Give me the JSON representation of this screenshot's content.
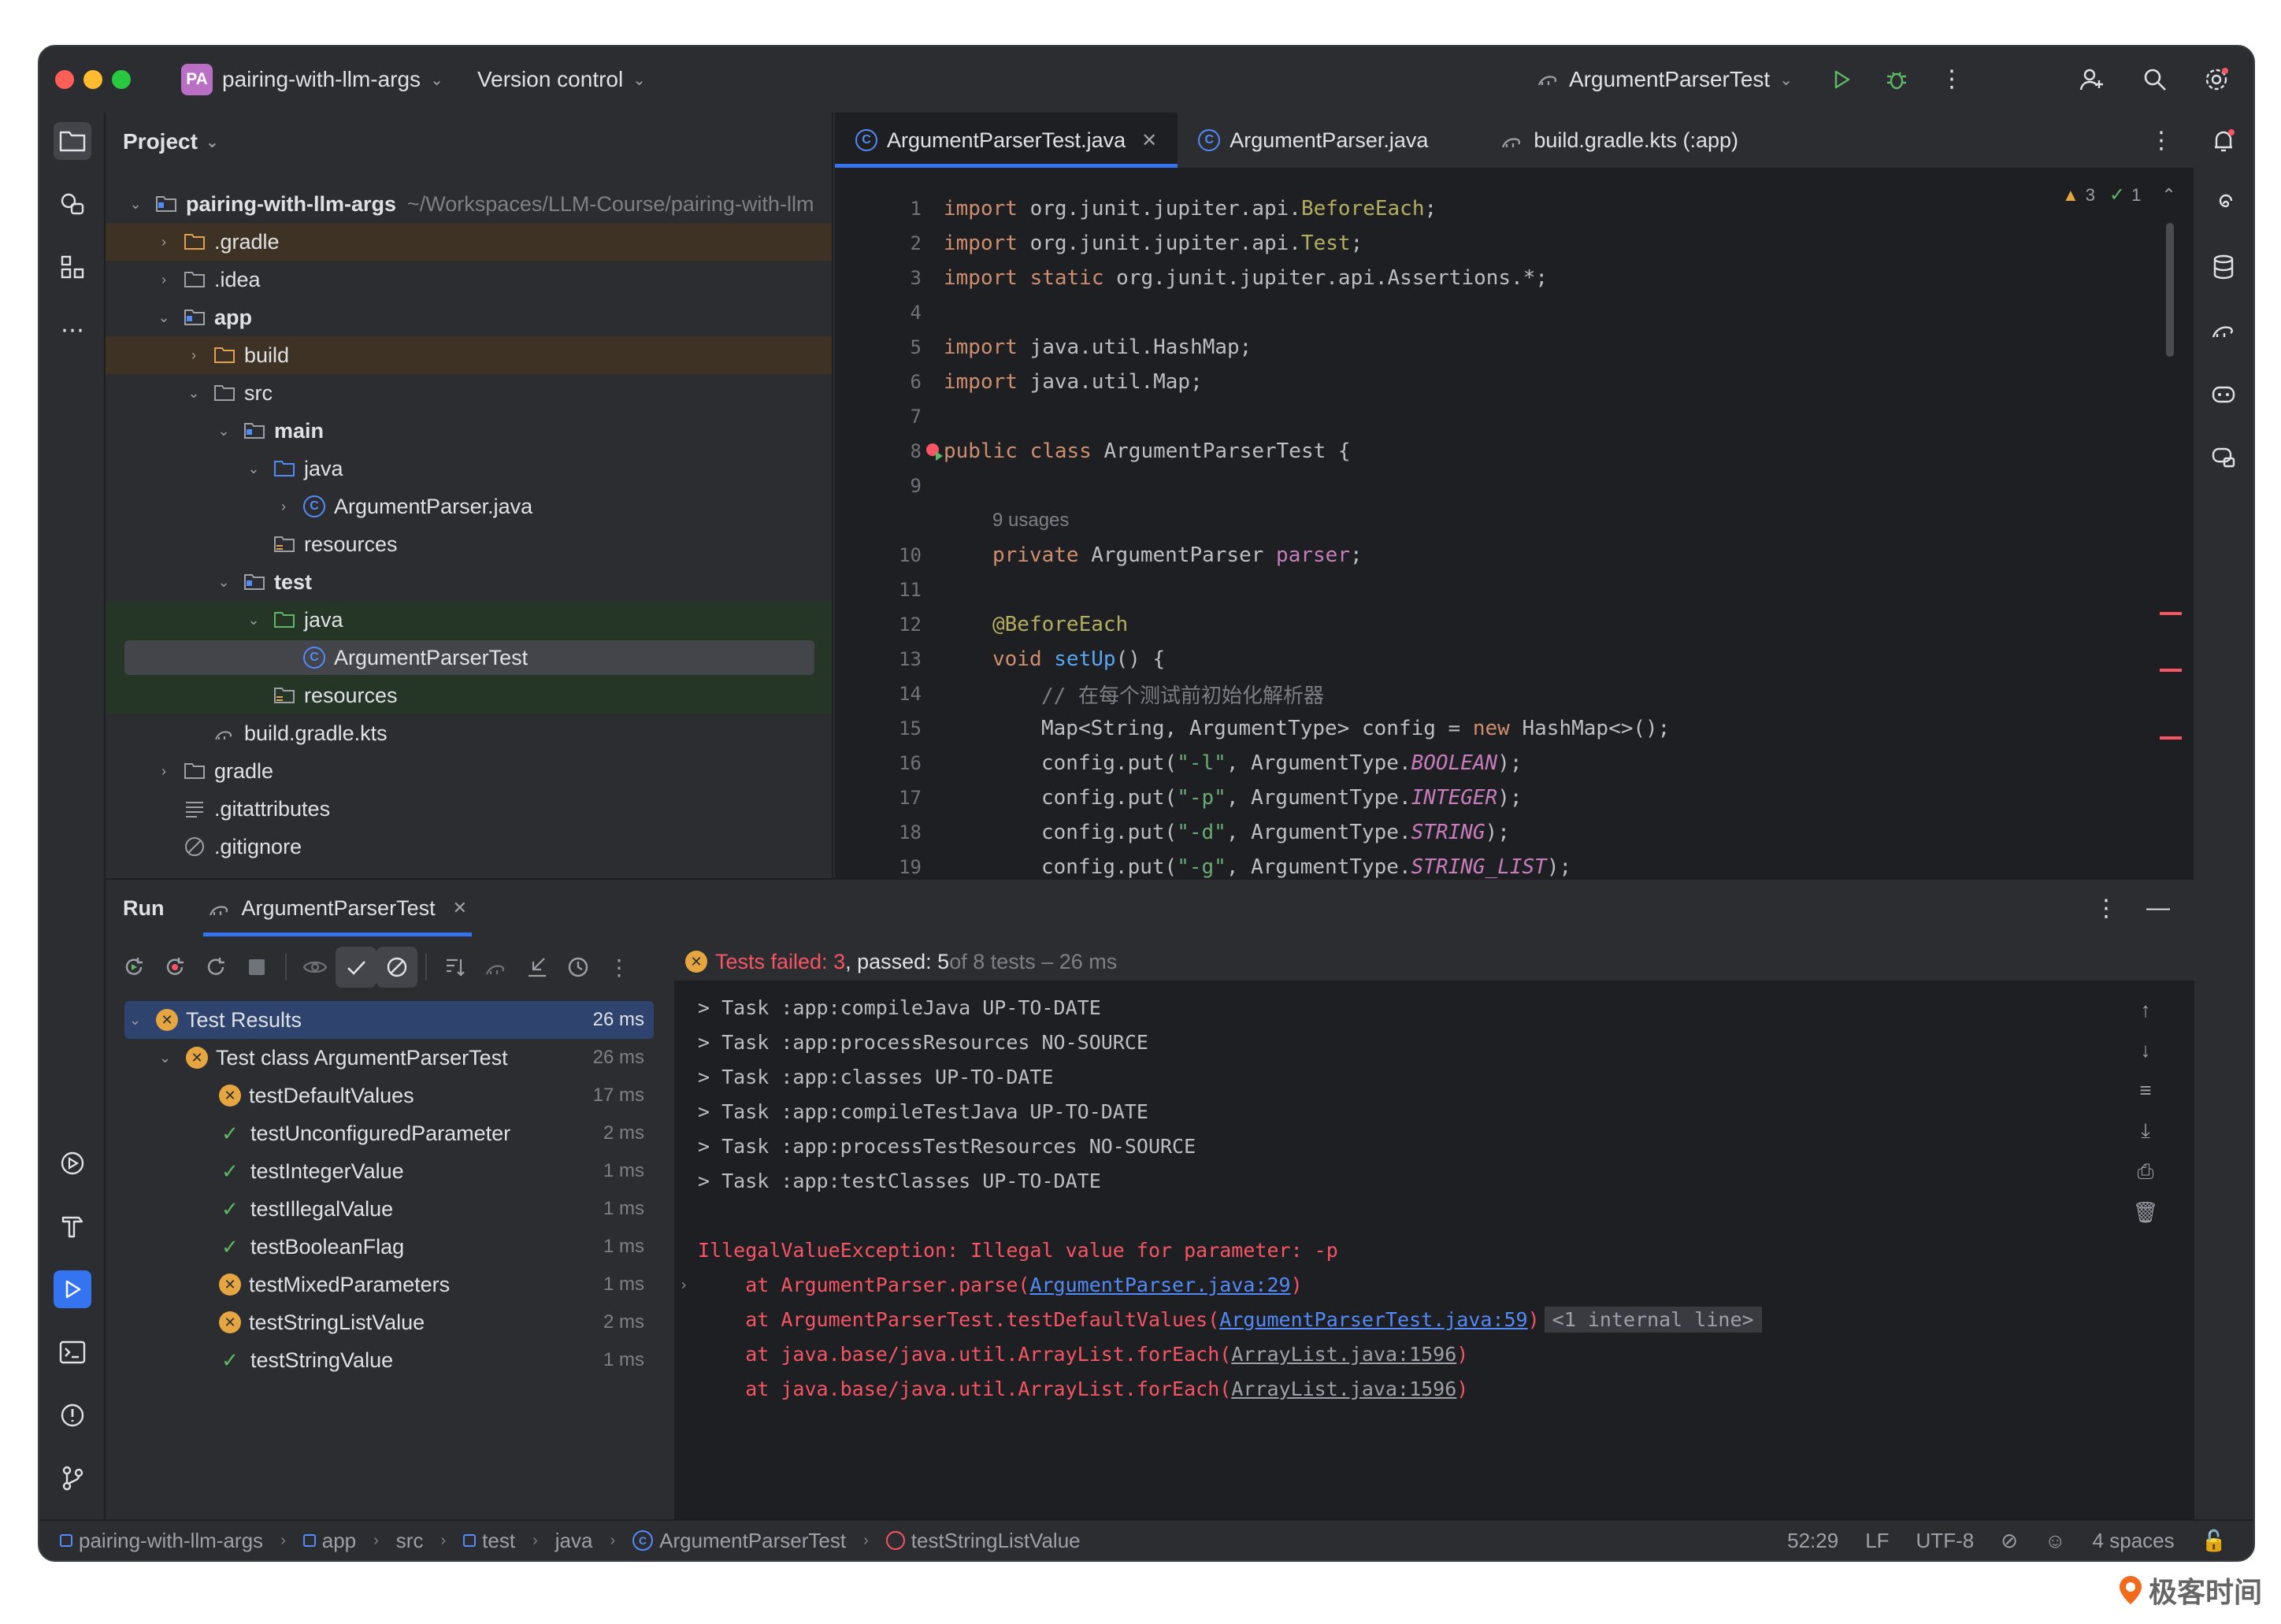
{
  "titlebar": {
    "project_badge": "PA",
    "project_name": "pairing-with-llm-args",
    "version_control": "Version control",
    "run_config": "ArgumentParserTest"
  },
  "project_panel": {
    "title": "Project",
    "root_name": "pairing-with-llm-args",
    "root_path": "~/Workspaces/LLM-Course/pairing-with-llm",
    "items": [
      {
        "label": ".gradle"
      },
      {
        "label": ".idea"
      },
      {
        "label": "app"
      },
      {
        "label": "build"
      },
      {
        "label": "src"
      },
      {
        "label": "main"
      },
      {
        "label": "java"
      },
      {
        "label": "ArgumentParser.java"
      },
      {
        "label": "resources"
      },
      {
        "label": "test"
      },
      {
        "label": "java"
      },
      {
        "label": "ArgumentParserTest"
      },
      {
        "label": "resources"
      },
      {
        "label": "build.gradle.kts"
      },
      {
        "label": "gradle"
      },
      {
        "label": ".gitattributes"
      },
      {
        "label": ".gitignore"
      }
    ]
  },
  "editor": {
    "tabs": [
      {
        "label": "ArgumentParserTest.java"
      },
      {
        "label": "ArgumentParser.java"
      },
      {
        "label": "build.gradle.kts (:app)"
      }
    ],
    "inspection": {
      "warnings": "3",
      "checks": "1"
    },
    "line_numbers": [
      "1",
      "2",
      "3",
      "4",
      "5",
      "6",
      "7",
      "8",
      "9",
      "10",
      "11",
      "12",
      "13",
      "14",
      "15",
      "16",
      "17",
      "18",
      "19"
    ],
    "usages_hint": "9 usages",
    "lines": {
      "l1": [
        "import ",
        "org.junit.jupiter.api.",
        "BeforeEach",
        ";"
      ],
      "l2": [
        "import ",
        "org.junit.jupiter.api.",
        "Test",
        ";"
      ],
      "l3": [
        "import static ",
        "org.junit.jupiter.api.Assertions.*;"
      ],
      "l5": [
        "import ",
        "java.util.HashMap;"
      ],
      "l6": [
        "import ",
        "java.util.Map;"
      ],
      "l8": [
        "public class ",
        "ArgumentParserTest {"
      ],
      "l10": [
        "private ",
        "ArgumentParser ",
        "parser",
        ";"
      ],
      "l12": [
        "@BeforeEach"
      ],
      "l13": [
        "void ",
        "setUp",
        "() {"
      ],
      "l14": [
        "// 在每个测试前初始化解析器"
      ],
      "l15": [
        "Map<String, ArgumentType> config = ",
        "new ",
        "HashMap<>();"
      ],
      "l16": [
        "config.put(",
        "\"-l\"",
        ", ArgumentType.",
        "BOOLEAN",
        ");"
      ],
      "l17": [
        "config.put(",
        "\"-p\"",
        ", ArgumentType.",
        "INTEGER",
        ");"
      ],
      "l18": [
        "config.put(",
        "\"-d\"",
        ", ArgumentType.",
        "STRING",
        ");"
      ],
      "l19": [
        "config.put(",
        "\"-g\"",
        ", ArgumentType.",
        "STRING_LIST",
        ");"
      ]
    }
  },
  "run_panel": {
    "title": "Run",
    "tab_label": "ArgumentParserTest",
    "summary": {
      "failed": "Tests failed: 3",
      "passed": ", passed: 5",
      "rest": " of 8 tests – 26 ms"
    },
    "results": [
      {
        "label": "Test Results",
        "time": "26 ms",
        "status": "fail"
      },
      {
        "label": "Test class ArgumentParserTest",
        "time": "26 ms",
        "status": "fail"
      },
      {
        "label": "testDefaultValues",
        "time": "17 ms",
        "status": "fail"
      },
      {
        "label": "testUnconfiguredParameter",
        "time": "2 ms",
        "status": "pass"
      },
      {
        "label": "testIntegerValue",
        "time": "1 ms",
        "status": "pass"
      },
      {
        "label": "testIllegalValue",
        "time": "1 ms",
        "status": "pass"
      },
      {
        "label": "testBooleanFlag",
        "time": "1 ms",
        "status": "pass"
      },
      {
        "label": "testMixedParameters",
        "time": "1 ms",
        "status": "fail"
      },
      {
        "label": "testStringListValue",
        "time": "2 ms",
        "status": "fail"
      },
      {
        "label": "testStringValue",
        "time": "1 ms",
        "status": "pass"
      }
    ],
    "console": {
      "tasks": [
        "> Task :app:compileJava UP-TO-DATE",
        "> Task :app:processResources NO-SOURCE",
        "> Task :app:classes UP-TO-DATE",
        "> Task :app:compileTestJava UP-TO-DATE",
        "> Task :app:processTestResources NO-SOURCE",
        "> Task :app:testClasses UP-TO-DATE"
      ],
      "exception": "IllegalValueException: Illegal value for parameter: -p",
      "trace1_pre": "    at ArgumentParser.parse(",
      "trace1_link": "ArgumentParser.java:29",
      "trace2_pre": "    at ArgumentParserTest.testDefaultValues(",
      "trace2_link": "ArgumentParserTest.java:59",
      "trace2_chip": "<1 internal line>",
      "trace3_pre": "    at java.base/java.util.ArrayList.forEach(",
      "trace3_link": "ArrayList.java:1596",
      "trace4_pre": "    at java.base/java.util.ArrayList.forEach(",
      "trace4_link": "ArrayList.java:1596",
      "close_paren": ")"
    }
  },
  "statusbar": {
    "crumbs": [
      "pairing-with-llm-args",
      "app",
      "src",
      "test",
      "java",
      "ArgumentParserTest",
      "testStringListValue"
    ],
    "position": "52:29",
    "line_sep": "LF",
    "encoding": "UTF-8",
    "indent": "4 spaces"
  },
  "watermark": "极客时间",
  "colors": {
    "accent": "#3574f0",
    "error": "#f75464",
    "warning": "#e5a541",
    "success": "#5fb865"
  }
}
